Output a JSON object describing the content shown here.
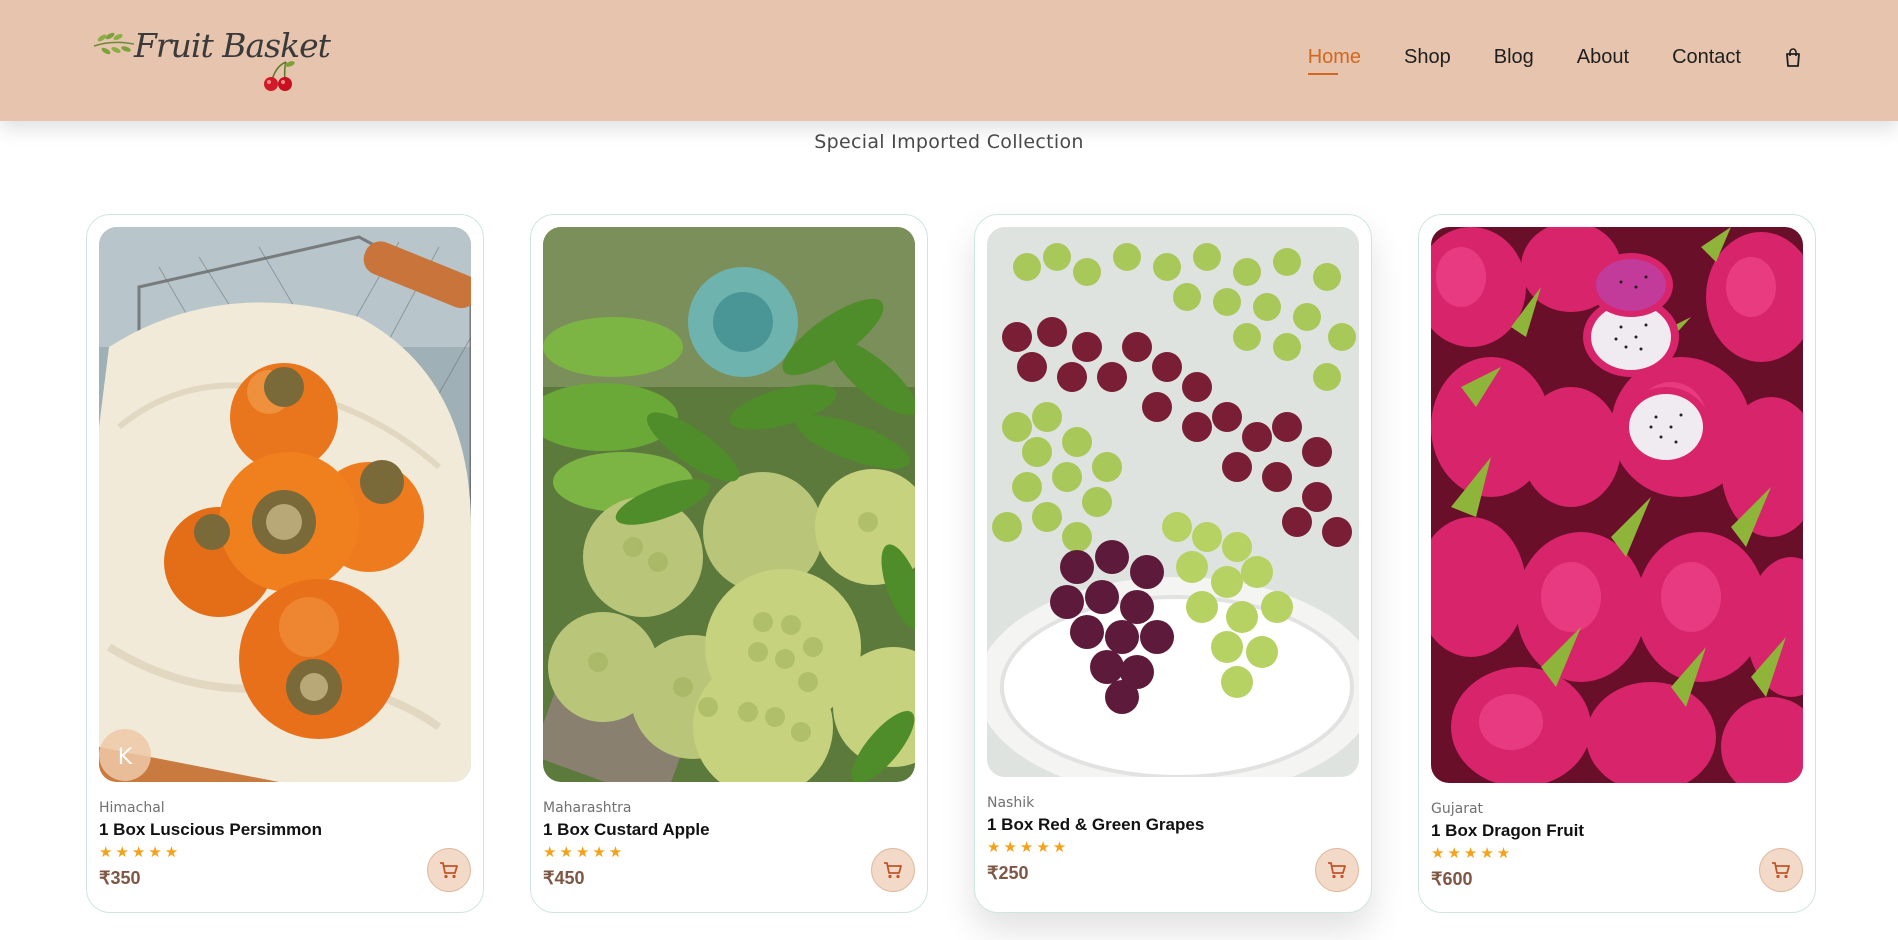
{
  "brand": {
    "logo_text": "Fruit Basket"
  },
  "nav": {
    "items": [
      {
        "label": "Home",
        "active": true
      },
      {
        "label": "Shop",
        "active": false
      },
      {
        "label": "Blog",
        "active": false
      },
      {
        "label": "About",
        "active": false
      },
      {
        "label": "Contact",
        "active": false
      }
    ],
    "bag_icon": "shopping-bag-icon"
  },
  "section": {
    "subtitle": "Special Imported Collection"
  },
  "products": [
    {
      "origin": "Himachal",
      "name": "1 Box Luscious Persimmon",
      "rating": 5,
      "stars": "★★★★★",
      "price": "₹350",
      "image": "persimmon basket"
    },
    {
      "origin": "Maharashtra",
      "name": "1 Box Custard Apple",
      "rating": 5,
      "stars": "★★★★★",
      "price": "₹450",
      "image": "custard apples with leaves"
    },
    {
      "origin": "Nashik",
      "name": "1 Box Red & Green Grapes",
      "rating": 5,
      "stars": "★★★★★",
      "price": "₹250",
      "image": "red and green grapes on plate"
    },
    {
      "origin": "Gujarat",
      "name": "1 Box Dragon Fruit",
      "rating": 5,
      "stars": "★★★★★",
      "price": "₹600",
      "image": "dragon fruits"
    }
  ],
  "colors": {
    "header_bg": "#e6c4ae",
    "accent": "#d2681f",
    "star": "#f4a21a",
    "price": "#7d5743",
    "cart_button_bg": "#f3d9c7",
    "card_border": "#cfe6df"
  }
}
